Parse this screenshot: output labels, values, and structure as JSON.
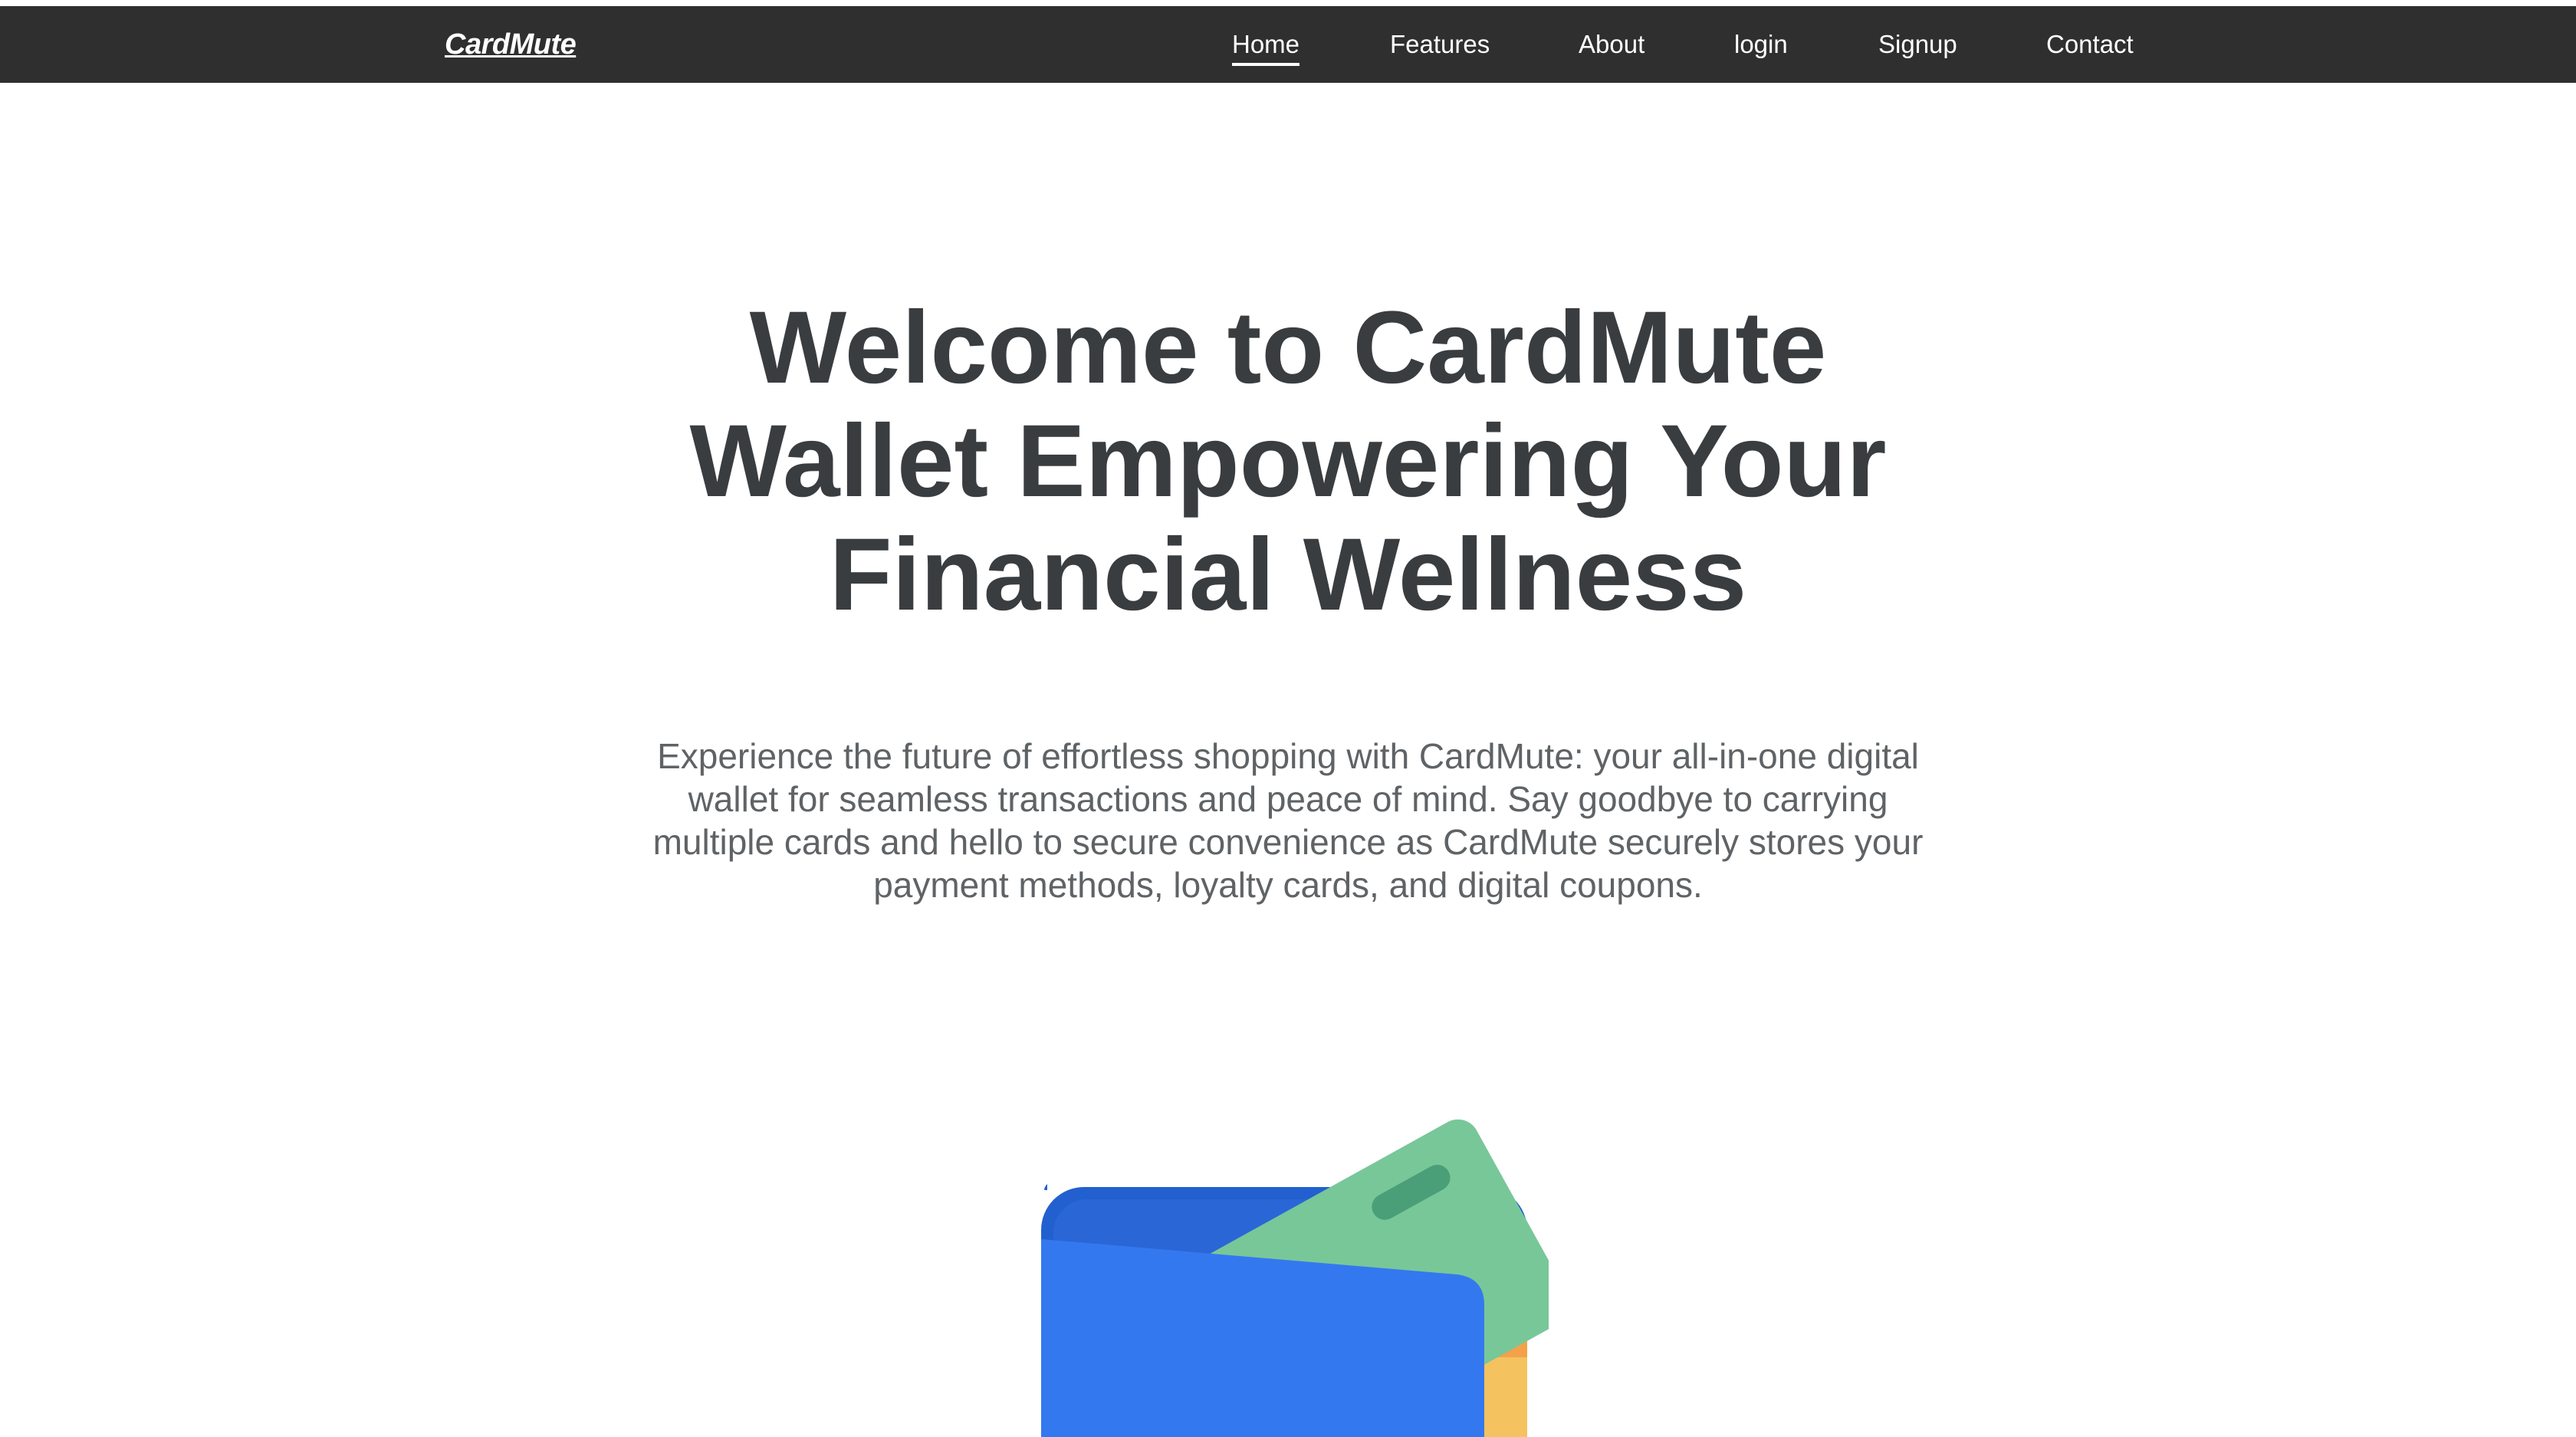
{
  "navbar": {
    "brand": "CardMute",
    "links": [
      {
        "label": "Home",
        "active": true
      },
      {
        "label": "Features",
        "active": false
      },
      {
        "label": "About",
        "active": false
      },
      {
        "label": "login",
        "active": false
      },
      {
        "label": "Signup",
        "active": false
      },
      {
        "label": "Contact",
        "active": false
      }
    ]
  },
  "hero": {
    "title": "Welcome to CardMute Wallet Empowering Your Financial Wellness",
    "description": "Experience the future of effortless shopping with CardMute: your all-in-one digital wallet for seamless transactions and peace of mind. Say goodbye to carrying multiple cards and hello to secure convenience as CardMute securely stores your payment methods, loyalty cards, and digital coupons.",
    "illustration": "wallet-icon"
  },
  "colors": {
    "navbar_bg": "#2f2f2f",
    "title": "#3a3d40",
    "body_text": "#5f6366",
    "wallet_blue": "#3478f0",
    "wallet_dark_blue": "#2260d0",
    "card_green": "#78c799",
    "card_orange": "#f3a14a",
    "card_yellow": "#f4c25f"
  }
}
